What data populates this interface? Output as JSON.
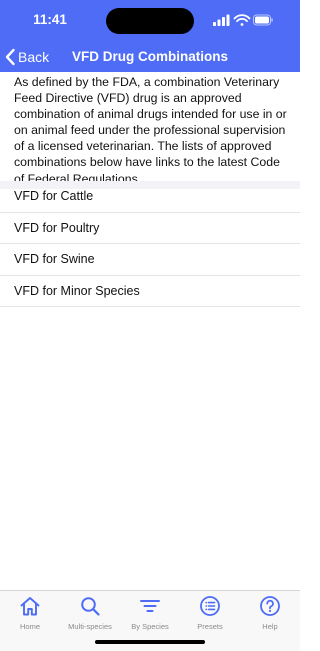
{
  "status_bar": {
    "time": "11:41"
  },
  "nav": {
    "back_label": "Back",
    "title": "VFD Drug Combinations"
  },
  "intro": "As defined by the FDA, a combination Veterinary Feed Directive (VFD) drug is an approved combination of animal drugs intended for use in or on animal feed under the professional supervision of a licensed veterinarian. The lists of approved combinations below have links to the latest Code of Federal Regulations.",
  "list": [
    {
      "label": "VFD for Cattle"
    },
    {
      "label": "VFD for Poultry"
    },
    {
      "label": "VFD for Swine"
    },
    {
      "label": "VFD for Minor Species"
    }
  ],
  "tabs": [
    {
      "label": "Home",
      "icon": "home-icon"
    },
    {
      "label": "Multi-species",
      "icon": "search-icon"
    },
    {
      "label": "By Species",
      "icon": "filter-icon"
    },
    {
      "label": "Presets",
      "icon": "list-icon"
    },
    {
      "label": "Help",
      "icon": "help-icon"
    }
  ],
  "colors": {
    "accent": "#4e6cf6",
    "tab_icon": "#4e6cf6",
    "tab_label": "#8a8a8e"
  }
}
